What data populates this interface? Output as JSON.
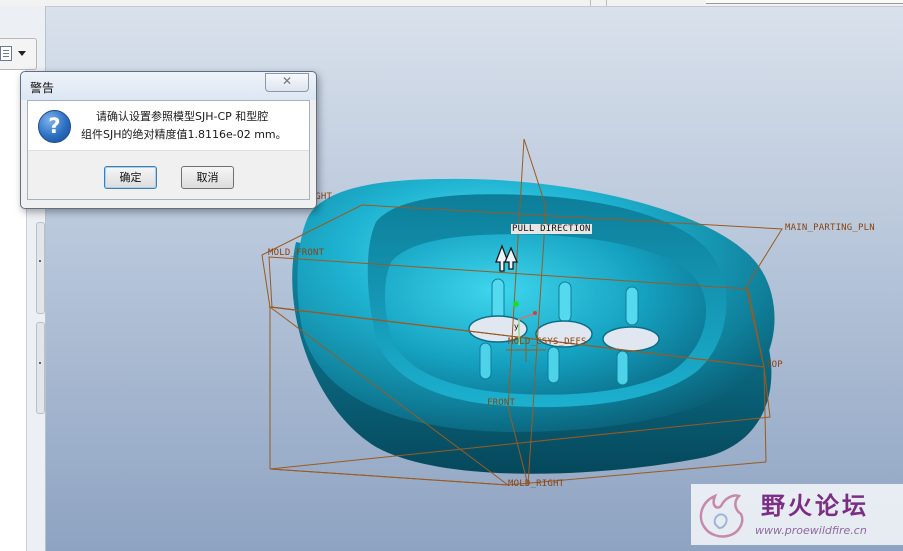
{
  "dialog": {
    "title": "警告",
    "close_glyph": "✕",
    "message_line1": "请确认设置参照模型SJH-CP 和型腔",
    "message_line2": "组件SJH的绝对精度值1.8116e-02 mm。",
    "ok_label": "确定",
    "cancel_label": "取消",
    "icon": "question-icon"
  },
  "viewport": {
    "labels": {
      "right": "RIGHT",
      "mold_front": "MOLD_FRONT",
      "pull_direction": "PULL DIRECTION",
      "main_parting_pln": "MAIN_PARTING_PLN",
      "csys": "MOLD_CSYS_DEFS",
      "top": "TOP",
      "front": "FRONT",
      "mold_right": "MOLD_RIGHT"
    },
    "model_color": "#1aa7c4",
    "datum_color": "#9a5a22"
  },
  "left_panel": {
    "toolbar_icon": "document-icon",
    "dropdown_icon": "dropdown-arrow-icon"
  },
  "watermark": {
    "site_name": "野火论坛",
    "url": "www.proewildfire.cn"
  }
}
